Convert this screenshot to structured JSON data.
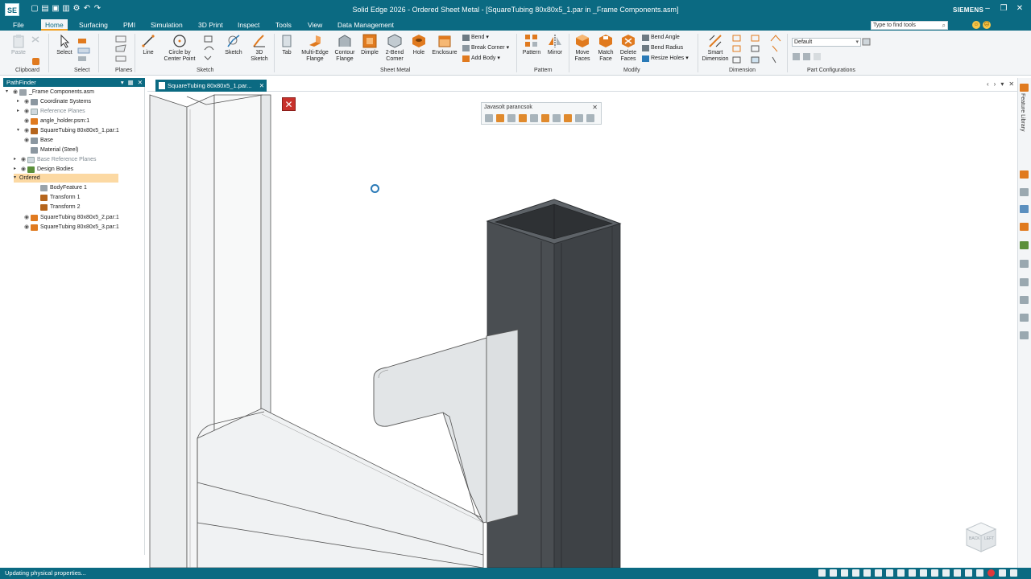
{
  "app": {
    "logo": "SE",
    "title": "Solid Edge 2026 - Ordered Sheet Metal - [SquareTubing 80x80x5_1.par in _Frame Components.asm]",
    "brand": "SIEMENS",
    "find_placeholder": "Type to find tools"
  },
  "menu": [
    "File",
    "Home",
    "Surfacing",
    "PMI",
    "Simulation",
    "3D Print",
    "Inspect",
    "Tools",
    "View",
    "Data Management"
  ],
  "ribbon": {
    "clipboard": {
      "paste": "Paste",
      "group": "Clipboard"
    },
    "select": {
      "select": "Select",
      "group": "Select"
    },
    "planes": {
      "group": "Planes"
    },
    "sketch": {
      "line": "Line",
      "circle": "Circle by\nCenter Point",
      "sketch": "Sketch",
      "sketch3d": "3D\nSketch",
      "group": "Sketch"
    },
    "sheet_metal": {
      "tab": "Tab",
      "multi_edge": "Multi-Edge\nFlange",
      "contour": "Contour\nFlange",
      "dimple": "Dimple",
      "corner": "2-Bend\nCorner",
      "hole": "Hole",
      "enclosure": "Enclosure",
      "bend": "Bend",
      "break_corner": "Break Corner",
      "add_body": "Add Body",
      "group": "Sheet Metal"
    },
    "pattern": {
      "pattern": "Pattern",
      "mirror": "Mirror",
      "group": "Pattern"
    },
    "modify": {
      "move_faces": "Move\nFaces",
      "match_face": "Match\nFace",
      "delete_faces": "Delete\nFaces",
      "bend_angle": "Bend Angle",
      "bend_radius": "Bend Radius",
      "resize_holes": "Resize Holes",
      "group": "Modify"
    },
    "dimension": {
      "smart": "Smart\nDimension",
      "group": "Dimension"
    },
    "part_config": {
      "value": "Default",
      "group": "Part Configurations"
    }
  },
  "pathfinder": {
    "title": "PathFinder",
    "items": [
      {
        "label": "_Frame Components.asm"
      },
      {
        "label": "Coordinate Systems"
      },
      {
        "label": "Reference Planes"
      },
      {
        "label": "angle_holder.psm:1"
      },
      {
        "label": "SquareTubing 80x80x5_1.par:1"
      },
      {
        "label": "Base"
      },
      {
        "label": "Material (Steel)"
      },
      {
        "label": "Base Reference Planes"
      },
      {
        "label": "Design Bodies"
      },
      {
        "label": "Ordered"
      },
      {
        "label": "BodyFeature 1"
      },
      {
        "label": "Transform 1"
      },
      {
        "label": "Transform 2"
      },
      {
        "label": "SquareTubing 80x80x5_2.par:1"
      },
      {
        "label": "SquareTubing 80x80x5_3.par:1"
      }
    ]
  },
  "document_tab": "SquareTubing 80x80x5_1.par...",
  "command_bar": {
    "title": "Javasolt parancsok"
  },
  "right_panel": {
    "feature_library": "Feature Library"
  },
  "viewcube": {
    "back": "BACK",
    "left": "LEFT"
  },
  "status": {
    "text": "Updating physical properties..."
  },
  "colors": {
    "accent": "#0b6a82",
    "highlight": "#fcd9a3",
    "tube_dark": "#4a4e52"
  }
}
